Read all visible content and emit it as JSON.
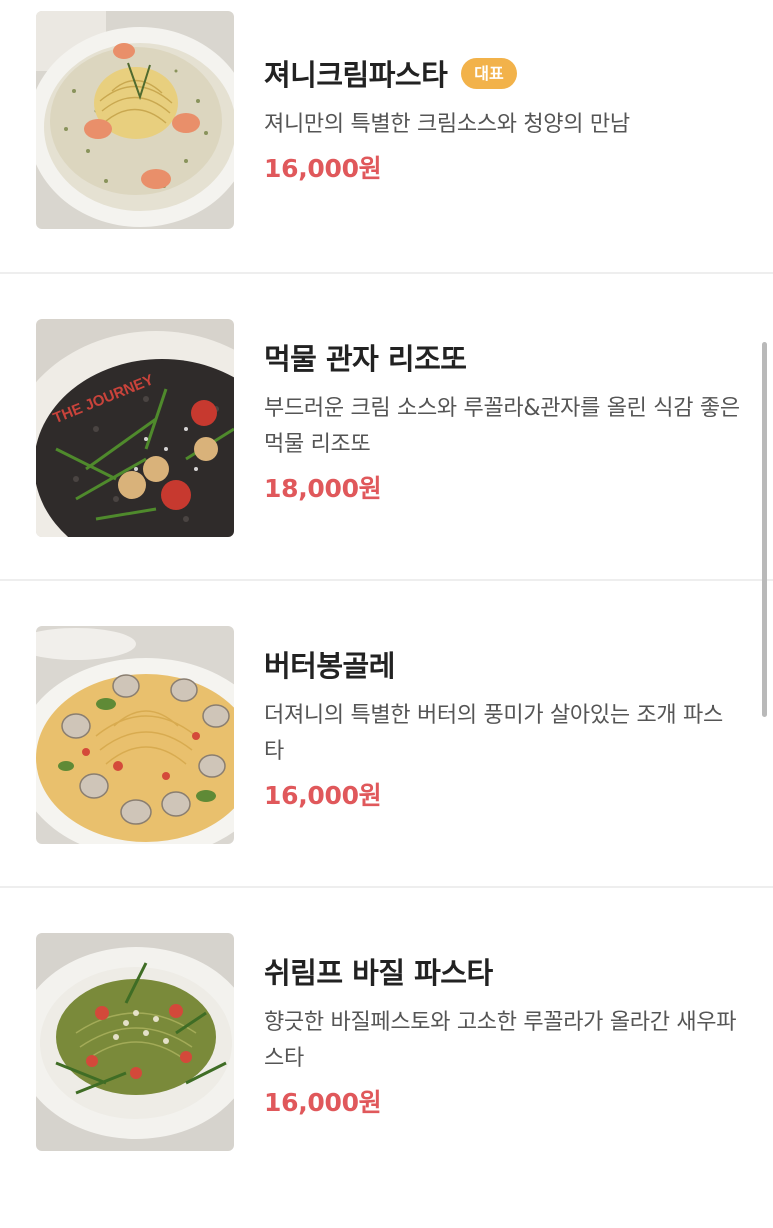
{
  "menu": {
    "items": [
      {
        "name": "져니크림파스타",
        "badge": "대표",
        "description": "져니만의 특별한 크림소스와 청양의 만남",
        "price": "16,000원",
        "photo_icon": "cream-pasta-photo"
      },
      {
        "name": "먹물 관자 리조또",
        "description": "부드러운 크림 소스와 루꼴라&관자를 올린 식감 좋은 먹물 리조또",
        "price": "18,000원",
        "photo_icon": "squid-ink-risotto-photo",
        "photo_text": "THE JOURNEY"
      },
      {
        "name": "버터봉골레",
        "description": "더져니의 특별한 버터의 풍미가 살아있는 조개 파스타",
        "price": "16,000원",
        "photo_icon": "butter-vongole-photo"
      },
      {
        "name": "쉬림프 바질 파스타",
        "description": "향긋한 바질페스토와 고소한 루꼴라가 올라간 새우파스타",
        "price": "16,000원",
        "photo_icon": "shrimp-basil-pasta-photo"
      }
    ]
  },
  "colors": {
    "price": "#e0585b",
    "badge_bg": "#f2b24a",
    "divider": "#eeeeee",
    "name_text": "#222222",
    "desc_text": "#555555"
  }
}
